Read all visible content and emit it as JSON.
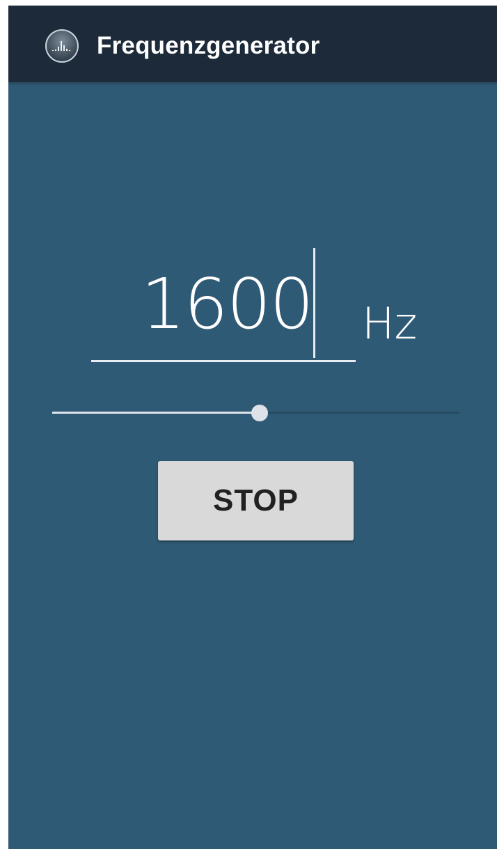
{
  "app": {
    "title": "Frequenzgenerator",
    "icon": "spectrum-icon"
  },
  "frequency": {
    "value": "1600",
    "unit": "Hz"
  },
  "slider": {
    "fraction": 0.51
  },
  "stop_button": {
    "label": "STOP"
  },
  "colors": {
    "appbar": "#1c2a3a",
    "background": "#2f5a75",
    "button": "#d9d9d9",
    "text": "#ffffff"
  }
}
